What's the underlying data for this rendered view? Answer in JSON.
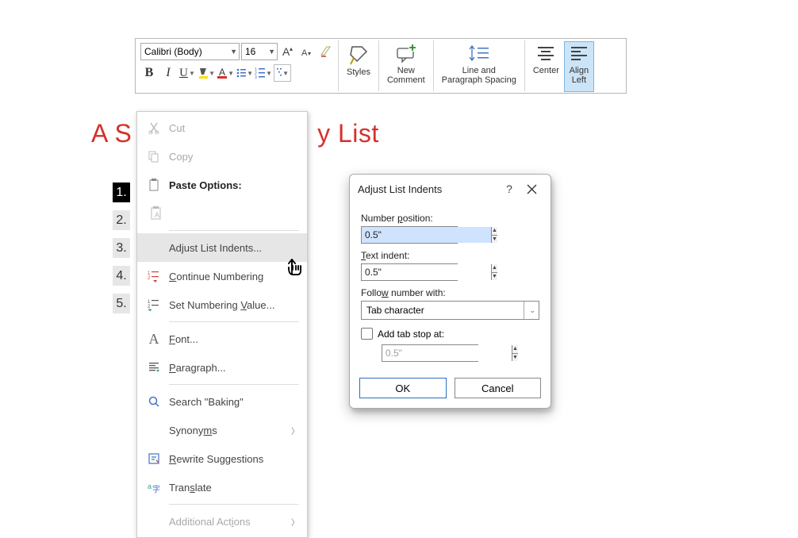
{
  "ribbon": {
    "font_name": "Calibri (Body)",
    "font_size": "16",
    "bold": "B",
    "italic": "I",
    "underline": "U",
    "styles_label": "Styles",
    "new_comment_l1": "New",
    "new_comment_l2": "Comment",
    "line_spacing_l1": "Line and",
    "line_spacing_l2": "Paragraph Spacing",
    "center_label": "Center",
    "align_left_l1": "Align",
    "align_left_l2": "Left"
  },
  "doc": {
    "heading_part1": "A S",
    "heading_part2": "y List",
    "list_numbers": [
      "1.",
      "2.",
      "3.",
      "4.",
      "5."
    ]
  },
  "ctx": {
    "cut": "Cut",
    "copy": "Copy",
    "paste_options": "Paste Options:",
    "adjust_list_indents": "Adjust List Indents...",
    "continue_numbering": "Continue Numbering",
    "set_numbering_value": "Set Numbering Value...",
    "font": "Font...",
    "paragraph": "Paragraph...",
    "search_baking": "Search \"Baking\"",
    "synonyms": "Synonyms",
    "rewrite": "Rewrite Suggestions",
    "translate": "Translate",
    "additional_actions": "Additional Actions"
  },
  "dialog": {
    "title": "Adjust List Indents",
    "number_position_label": "Number position:",
    "number_position_value": "0.5\"",
    "text_indent_label": "Text indent:",
    "text_indent_value": "0.5\"",
    "follow_label": "Follow number with:",
    "follow_value": "Tab character",
    "add_tab_stop_label": "Add tab stop at:",
    "add_tab_stop_value": "0.5\"",
    "ok": "OK",
    "cancel": "Cancel"
  }
}
